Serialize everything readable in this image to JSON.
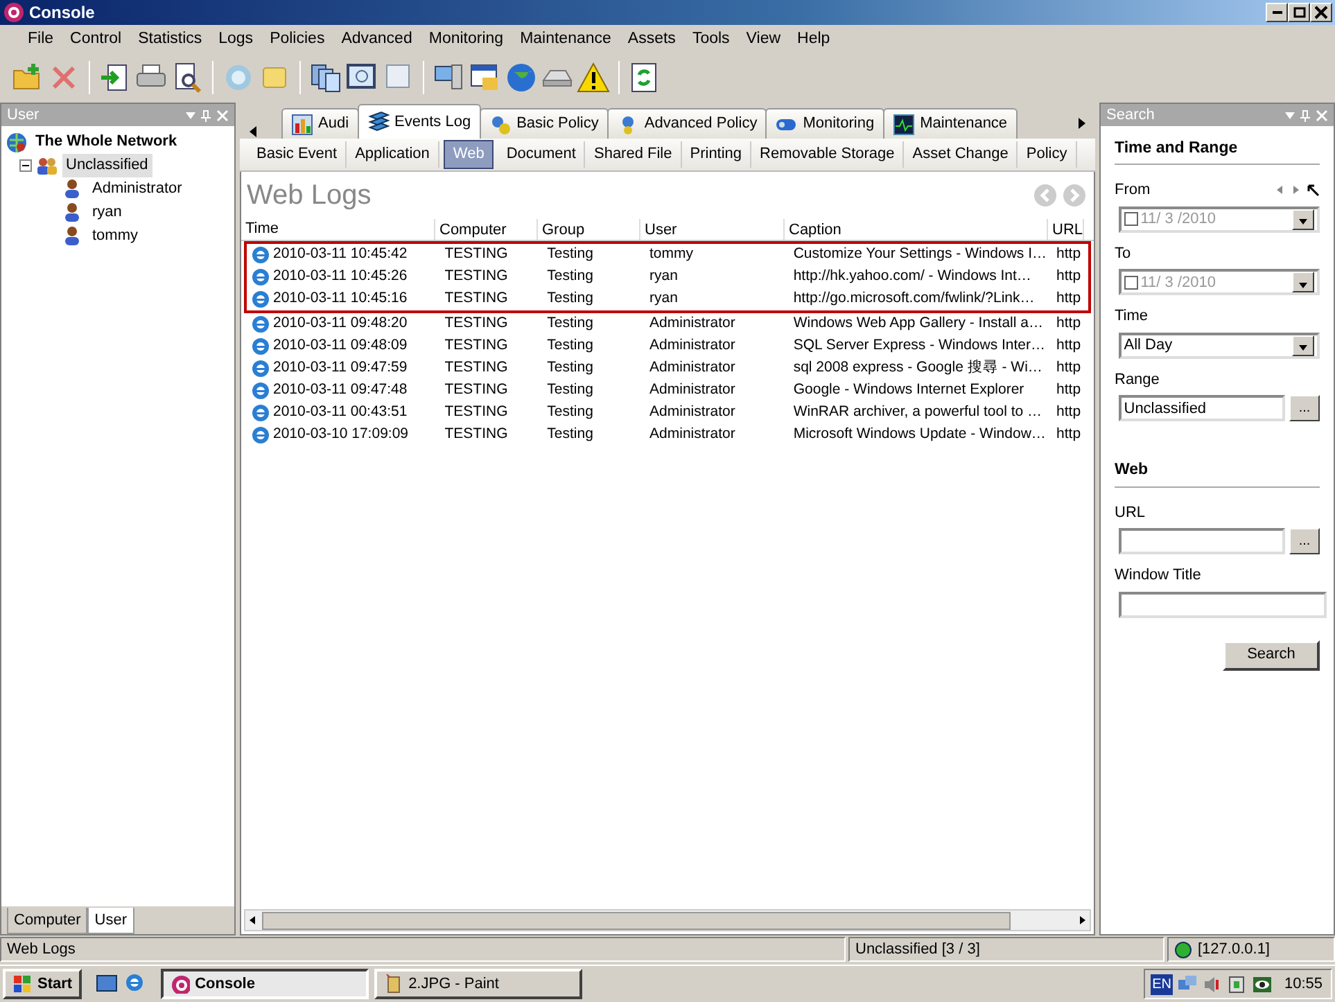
{
  "window": {
    "title": "Console"
  },
  "menu": [
    "File",
    "Control",
    "Statistics",
    "Logs",
    "Policies",
    "Advanced",
    "Monitoring",
    "Maintenance",
    "Assets",
    "Tools",
    "View",
    "Help"
  ],
  "left_panel": {
    "title": "User",
    "tree": [
      {
        "label": "The Whole Network",
        "selected": false,
        "children": [
          {
            "label": "Unclassified",
            "expanded": true,
            "selected": true,
            "children": [
              {
                "label": "Administrator",
                "selected": false
              },
              {
                "label": "ryan",
                "selected": false
              },
              {
                "label": "tommy",
                "selected": false
              }
            ]
          }
        ]
      }
    ],
    "tabs": [
      {
        "label": "Computer",
        "selected": false
      },
      {
        "label": "User",
        "selected": true
      }
    ]
  },
  "tabs": [
    {
      "label": "Audi",
      "selected": false
    },
    {
      "label": "Events Log",
      "selected": true
    },
    {
      "label": "Basic Policy",
      "selected": false
    },
    {
      "label": "Advanced Policy",
      "selected": false
    },
    {
      "label": "Monitoring",
      "selected": false
    },
    {
      "label": "Maintenance",
      "selected": false
    }
  ],
  "subtabs": [
    {
      "label": "Basic Event",
      "selected": false
    },
    {
      "label": "Application",
      "selected": false
    },
    {
      "label": "Web",
      "selected": true
    },
    {
      "label": "Document",
      "selected": false
    },
    {
      "label": "Shared File",
      "selected": false
    },
    {
      "label": "Printing",
      "selected": false
    },
    {
      "label": "Removable Storage",
      "selected": false
    },
    {
      "label": "Asset Change",
      "selected": false
    },
    {
      "label": "Policy",
      "selected": false
    }
  ],
  "heading": "Web Logs",
  "table": {
    "columns": [
      "Time",
      "Computer",
      "Group",
      "User",
      "Caption",
      "URL"
    ],
    "rows": [
      {
        "cells": [
          "2010-03-11 10:45:42",
          "TESTING",
          "Testing",
          "tommy",
          "Customize Your Settings - Windows I…",
          "http"
        ],
        "highlighted": true
      },
      {
        "cells": [
          "2010-03-11 10:45:26",
          "TESTING",
          "Testing",
          "ryan",
          "http://hk.yahoo.com/ - Windows Int…",
          "http"
        ],
        "highlighted": true
      },
      {
        "cells": [
          "2010-03-11 10:45:16",
          "TESTING",
          "Testing",
          "ryan",
          "http://go.microsoft.com/fwlink/?Link…",
          "http"
        ],
        "highlighted": true
      },
      {
        "cells": [
          "2010-03-11 09:48:20",
          "TESTING",
          "Testing",
          "Administrator",
          "Windows Web App Gallery - Install a…",
          "http"
        ],
        "highlighted": false
      },
      {
        "cells": [
          "2010-03-11 09:48:09",
          "TESTING",
          "Testing",
          "Administrator",
          "SQL Server Express - Windows Inter…",
          "http"
        ],
        "highlighted": false
      },
      {
        "cells": [
          "2010-03-11 09:47:59",
          "TESTING",
          "Testing",
          "Administrator",
          "sql 2008 express - Google 搜尋 - Wi…",
          "http"
        ],
        "highlighted": false
      },
      {
        "cells": [
          "2010-03-11 09:47:48",
          "TESTING",
          "Testing",
          "Administrator",
          "Google - Windows Internet Explorer",
          "http"
        ],
        "highlighted": false
      },
      {
        "cells": [
          "2010-03-11 00:43:51",
          "TESTING",
          "Testing",
          "Administrator",
          "WinRAR archiver, a powerful tool to …",
          "http"
        ],
        "highlighted": false
      },
      {
        "cells": [
          "2010-03-10 17:09:09",
          "TESTING",
          "Testing",
          "Administrator",
          "Microsoft Windows Update - Window…",
          "http"
        ],
        "highlighted": false
      }
    ]
  },
  "search_panel": {
    "title": "Search",
    "sections": [
      {
        "title": "Time and Range",
        "fields": [
          {
            "label": "From",
            "kind": "date",
            "value": "11/ 3 /2010",
            "checked": false,
            "disabled": true
          },
          {
            "label": "To",
            "kind": "date",
            "value": "11/ 3 /2010",
            "checked": false,
            "disabled": true
          },
          {
            "label": "Time",
            "kind": "select",
            "value": "All Day"
          },
          {
            "label": "Range",
            "kind": "browse",
            "value": "Unclassified",
            "button": "..."
          }
        ]
      },
      {
        "title": "Web",
        "fields": [
          {
            "label": "URL",
            "kind": "browse",
            "button": "..."
          },
          {
            "label": "Window Title",
            "kind": "text"
          }
        ]
      }
    ],
    "button": "Search"
  },
  "status_bar": {
    "left": "Web Logs",
    "middle": "Unclassified [3 / 3]",
    "connected": true,
    "address": "[127.0.0.1]"
  },
  "taskbar": {
    "start": "Start",
    "tasks": [
      {
        "label": "Console",
        "selected": true
      },
      {
        "label": "2.JPG - Paint",
        "selected": false
      }
    ],
    "language": "EN",
    "clock": "10:55"
  }
}
